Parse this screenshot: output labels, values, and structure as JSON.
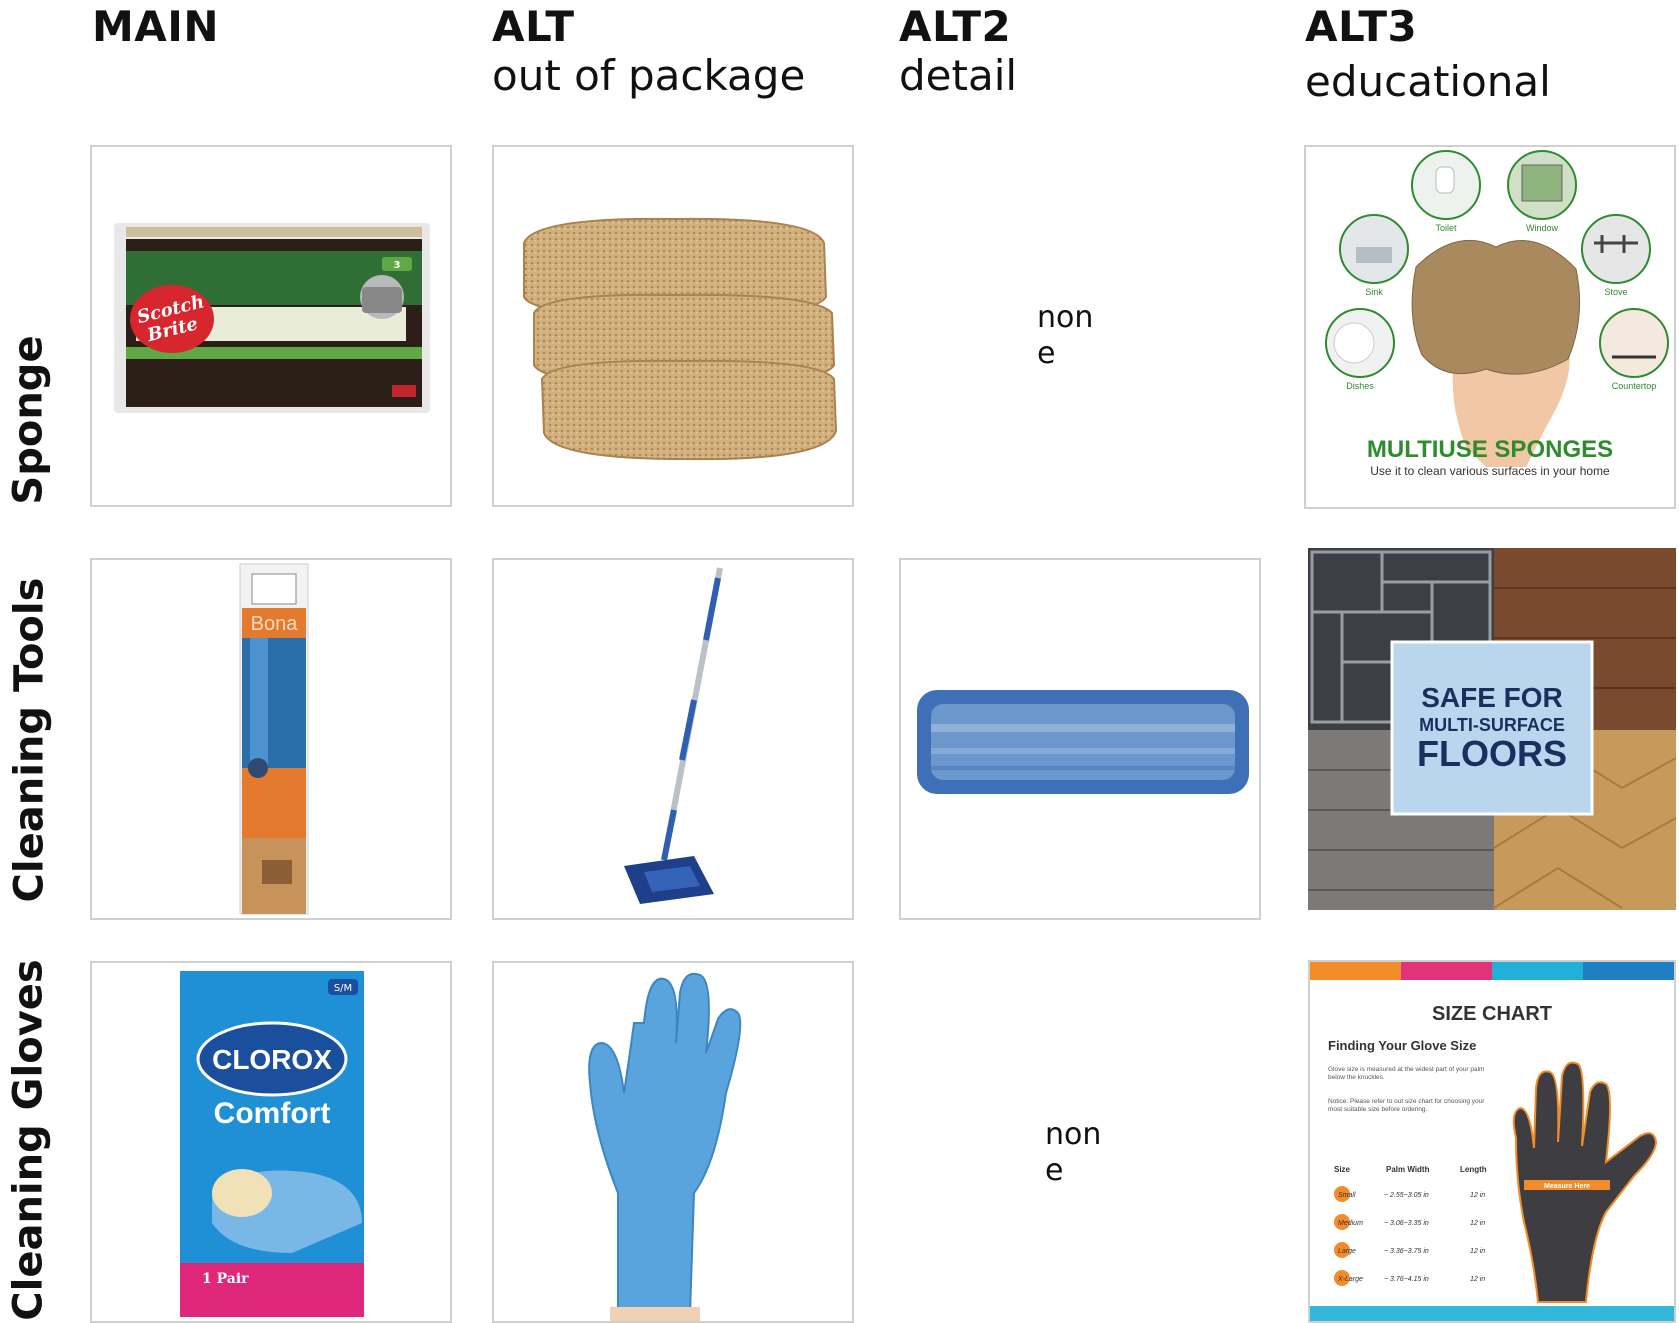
{
  "columns": [
    {
      "title": "MAIN",
      "subtitle": ""
    },
    {
      "title": "ALT",
      "subtitle": "out of package"
    },
    {
      "title": "ALT2",
      "subtitle": "detail"
    },
    {
      "title": "ALT3",
      "subtitle": "educational"
    }
  ],
  "rows": [
    {
      "label": "Sponge"
    },
    {
      "label": "Cleaning Tools"
    },
    {
      "label": "Cleaning Gloves"
    }
  ],
  "none_text": "none",
  "sponge": {
    "main": {
      "brand_line1": "Scotch",
      "brand_line2": "Brite",
      "count": "3"
    },
    "alt3": {
      "headline": "MULTIUSE SPONGES",
      "caption": "Use it to clean various surfaces in your home",
      "surfaces": [
        "Toilet",
        "Window",
        "Sink",
        "Stove",
        "Dishes",
        "Countertop"
      ]
    }
  },
  "tools": {
    "main": {
      "brand": "Bona"
    },
    "alt3": {
      "line1": "SAFE FOR",
      "line2": "MULTI-SURFACE",
      "line3": "FLOORS"
    }
  },
  "gloves": {
    "main": {
      "size_badge": "S/M",
      "brand": "CLOROX",
      "product": "Comfort",
      "count": "1 Pair"
    },
    "alt3": {
      "title": "SIZE CHART",
      "subtitle": "Finding Your Glove Size",
      "para1": "Glove size is measured at the widest part of your palm below the knuckles.",
      "para2": "Notice: Please refer to out size chart for choosing your most suitable size before ordering.",
      "headers": [
        "Size",
        "Palm Width",
        "Length"
      ],
      "table": [
        [
          "Small",
          "~ 2.55~3.05 in",
          "12 in"
        ],
        [
          "Medium",
          "~ 3.06~3.35 in",
          "12 in"
        ],
        [
          "Large",
          "~ 3.36~3.75 in",
          "12 in"
        ],
        [
          "X-Large",
          "~ 3.76~4.15 in",
          "12 in"
        ]
      ],
      "measure_label": "Measure Here"
    }
  },
  "colors": {
    "border": "#cfcfcf",
    "green": "#2e8b2e",
    "navy": "#1b2f5e",
    "orange": "#e8821e",
    "glove_blue": "#4f9bd6"
  }
}
